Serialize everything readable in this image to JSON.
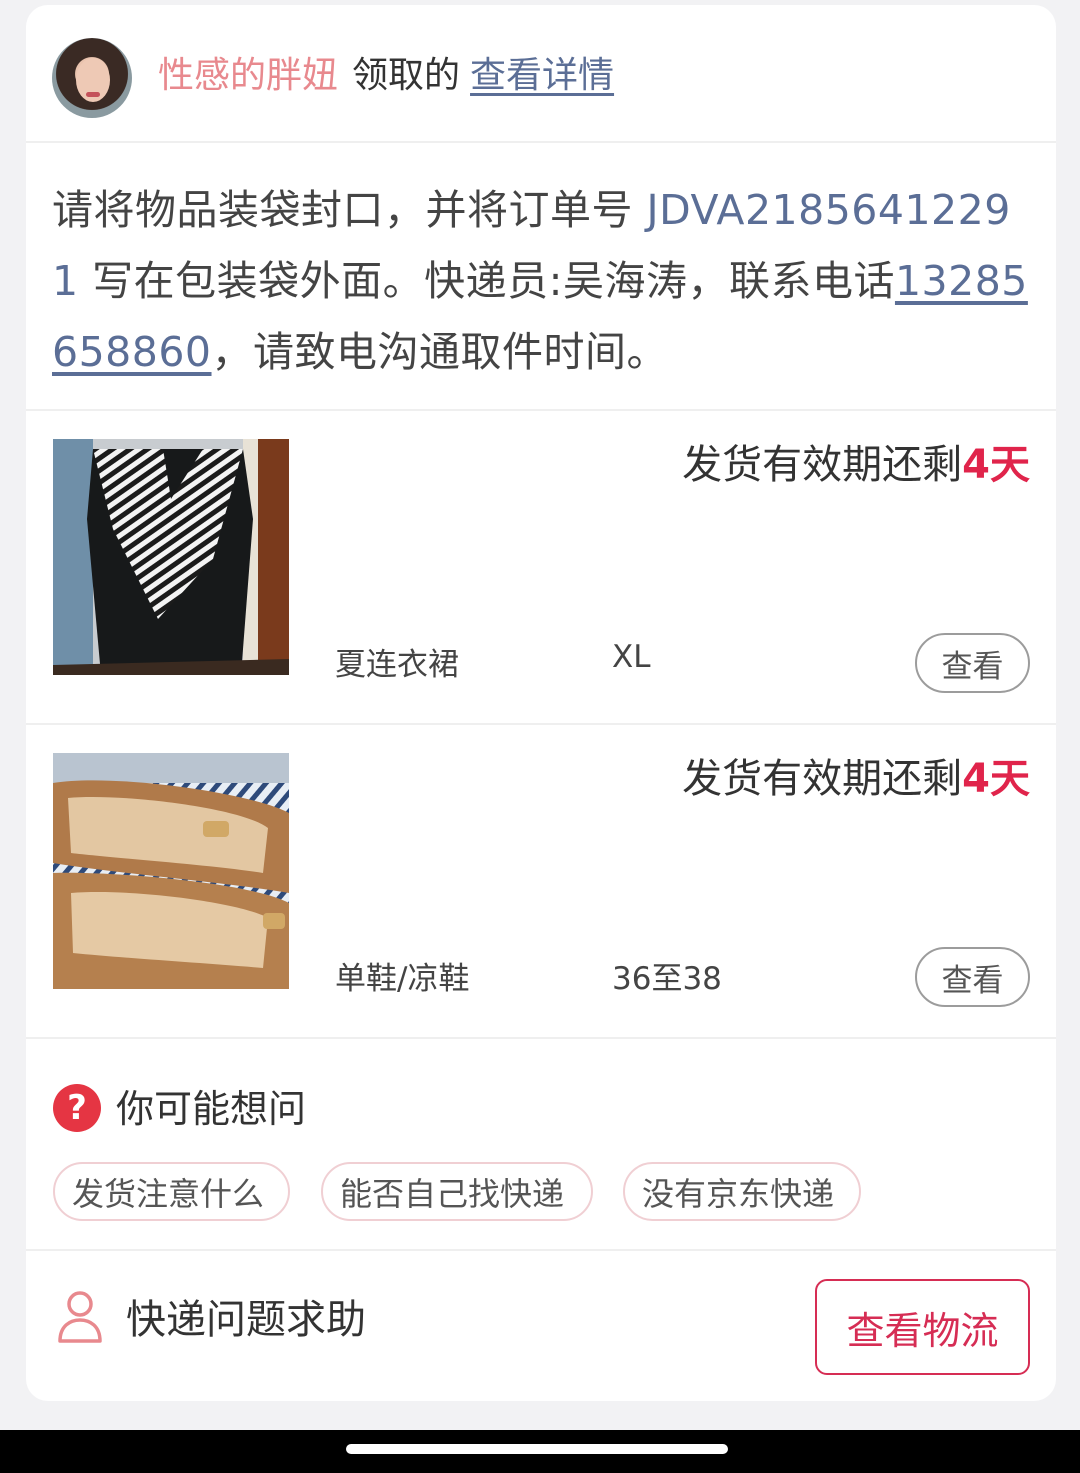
{
  "header": {
    "user_name": "性感的胖妞",
    "action": "领取的",
    "details_link": "查看详情"
  },
  "message": {
    "part1": "请将物品装袋封口，并将订单号 ",
    "order_no": "JDVA21856412291",
    "part2": " 写在包装袋外面。快递员:吴海涛，联系电话",
    "phone": "13285658860",
    "part3": "，请致电沟通取件时间。"
  },
  "items": [
    {
      "deadline_prefix": "发货有效期还剩",
      "days": "4天",
      "name": "夏连衣裙",
      "size": "XL",
      "view_label": "查看",
      "image": "black-white-striped-dress"
    },
    {
      "deadline_prefix": "发货有效期还剩",
      "days": "4天",
      "name": "单鞋/凉鞋",
      "size": "36至38",
      "view_label": "查看",
      "image": "tan-flat-shoes"
    }
  ],
  "faq": {
    "title": "你可能想问",
    "icon": "question-circle-icon",
    "chips": [
      "发货注意什么",
      "能否自己找快递",
      "没有京东快递"
    ]
  },
  "footer": {
    "help_text": "快递问题求助",
    "help_icon": "person-outline-icon",
    "logistics_button": "查看物流"
  },
  "colors": {
    "accent_red": "#d62d54",
    "days_red": "#e0244b",
    "link_blue": "#5b6e96",
    "name_pink": "#e8898e"
  }
}
